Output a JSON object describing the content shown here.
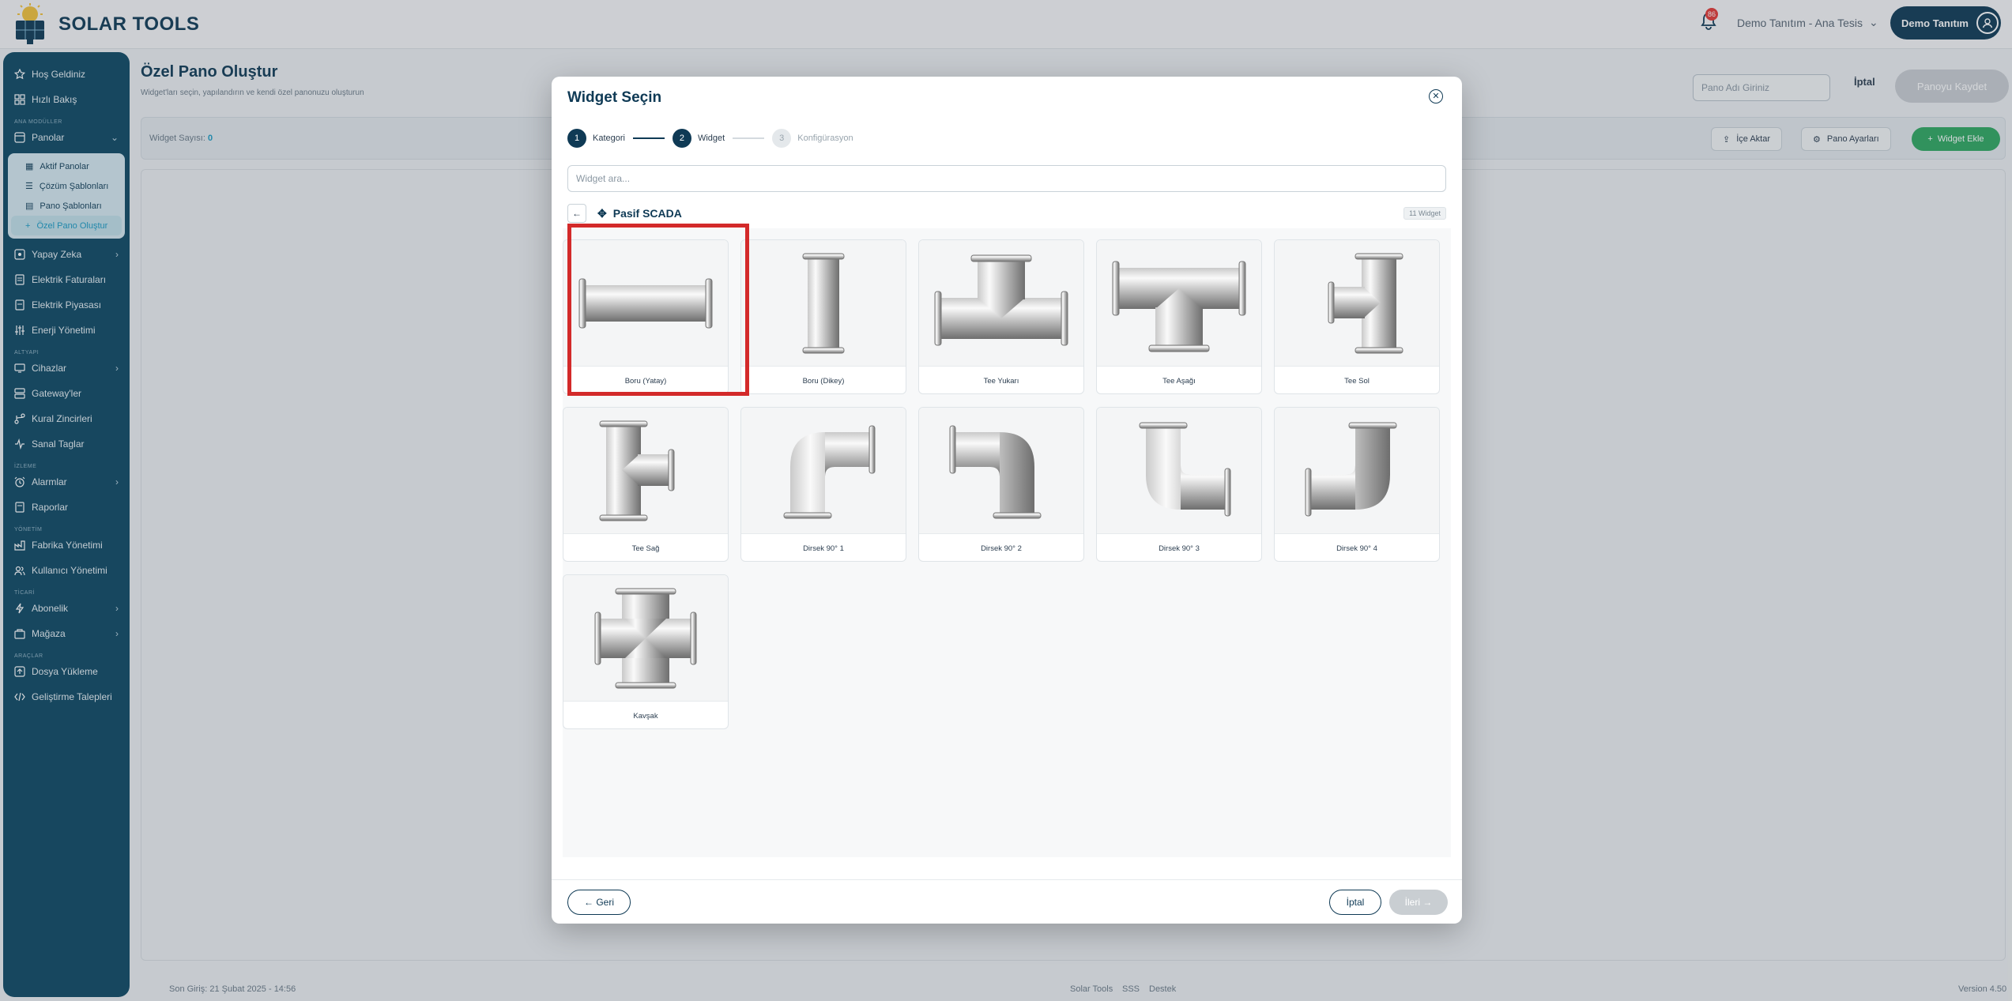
{
  "app": {
    "logo_text": "SOLAR TOOLS",
    "notification_count": "86",
    "tenant": "Demo Tanıtım - Ana Tesis",
    "user": "Demo Tanıtım"
  },
  "sidebar": {
    "welcome": "Hoş Geldiniz",
    "overview": "Hızlı Bakış",
    "section_main": "ANA MODÜLLER",
    "boards": "Panolar",
    "boards_sub": [
      "Aktif Panolar",
      "Çözüm Şablonları",
      "Pano Şablonları",
      "Özel Pano Oluştur"
    ],
    "ai": "Yapay Zeka",
    "invoices": "Elektrik Faturaları",
    "market": "Elektrik Piyasası",
    "energy": "Enerji Yönetimi",
    "section_infra": "ALTYAPI",
    "devices": "Cihazlar",
    "gateways": "Gateway'ler",
    "rules": "Kural Zincirleri",
    "virtual_tags": "Sanal Taglar",
    "section_monitor": "İZLEME",
    "alarms": "Alarmlar",
    "reports": "Raporlar",
    "section_admin": "YÖNETİM",
    "factory": "Fabrika Yönetimi",
    "users": "Kullanıcı Yönetimi",
    "section_commerce": "TİCARİ",
    "subscription": "Abonelik",
    "store": "Mağaza",
    "section_tools": "ARAÇLAR",
    "upload": "Dosya Yükleme",
    "dev_requests": "Geliştirme Talepleri"
  },
  "page": {
    "title": "Özel Pano Oluştur",
    "subtitle": "Widget'ları seçin, yapılandırın ve kendi özel panonuzu oluşturun",
    "name_placeholder": "Pano Adı Giriniz",
    "cancel": "İptal",
    "save": "Panoyu Kaydet",
    "widget_count_label": "Widget Sayısı:",
    "widget_count": "0",
    "import": "İçe Aktar",
    "settings": "Pano Ayarları",
    "add_widget": "Widget Ekle"
  },
  "footer": {
    "last_login": "Son Giriş: 21 Şubat 2025 - 14:56",
    "links": [
      "Solar Tools",
      "SSS",
      "Destek"
    ],
    "version": "Version 4.50"
  },
  "modal": {
    "title": "Widget Seçin",
    "steps": [
      {
        "num": "1",
        "label": "Kategori"
      },
      {
        "num": "2",
        "label": "Widget"
      },
      {
        "num": "3",
        "label": "Konfigürasyon"
      }
    ],
    "search_placeholder": "Widget ara...",
    "category": "Pasif SCADA",
    "category_count": "11 Widget",
    "widgets": [
      "Boru (Yatay)",
      "Boru (Dikey)",
      "Tee Yukarı",
      "Tee Aşağı",
      "Tee Sol",
      "Tee Sağ",
      "Dirsek 90° 1",
      "Dirsek 90° 2",
      "Dirsek 90° 3",
      "Dirsek 90° 4",
      "Kavşak"
    ],
    "selected": "Boru (Yatay)",
    "back": "← Geri",
    "cancel": "İptal",
    "next": "İleri →"
  },
  "colors": {
    "primary": "#0f3a55",
    "sidebar": "#0e4863",
    "accent": "#1a9cc4",
    "success": "#2fa860",
    "highlight": "#d32a2a"
  }
}
